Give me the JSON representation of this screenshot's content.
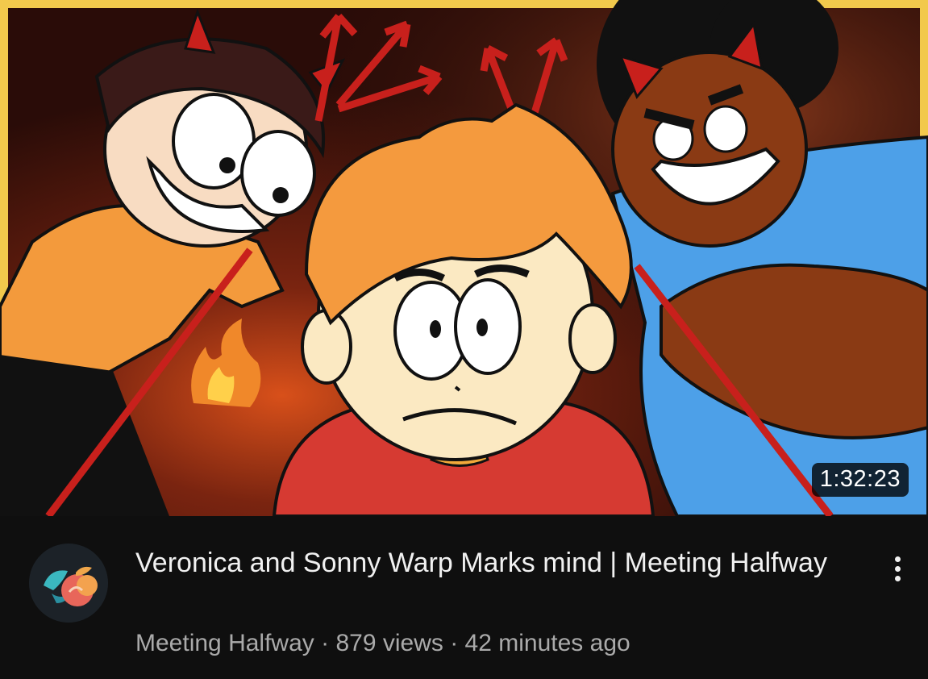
{
  "video": {
    "duration": "1:32:23",
    "title": "Veronica and Sonny Warp Marks mind | Meeting Halfway",
    "channel": "Meeting Halfway",
    "separator": "·",
    "views": "879 views",
    "uploaded": "42 minutes ago"
  },
  "icons": {
    "more": "more-vertical-icon",
    "avatar": "channel-avatar-peach-logo"
  },
  "colors": {
    "background": "#0f0f0f",
    "title": "#f1f1f1",
    "subtitle": "#aaaaaa",
    "thumbnail_border": "#f2c94c",
    "devil_red": "#c8201c"
  }
}
